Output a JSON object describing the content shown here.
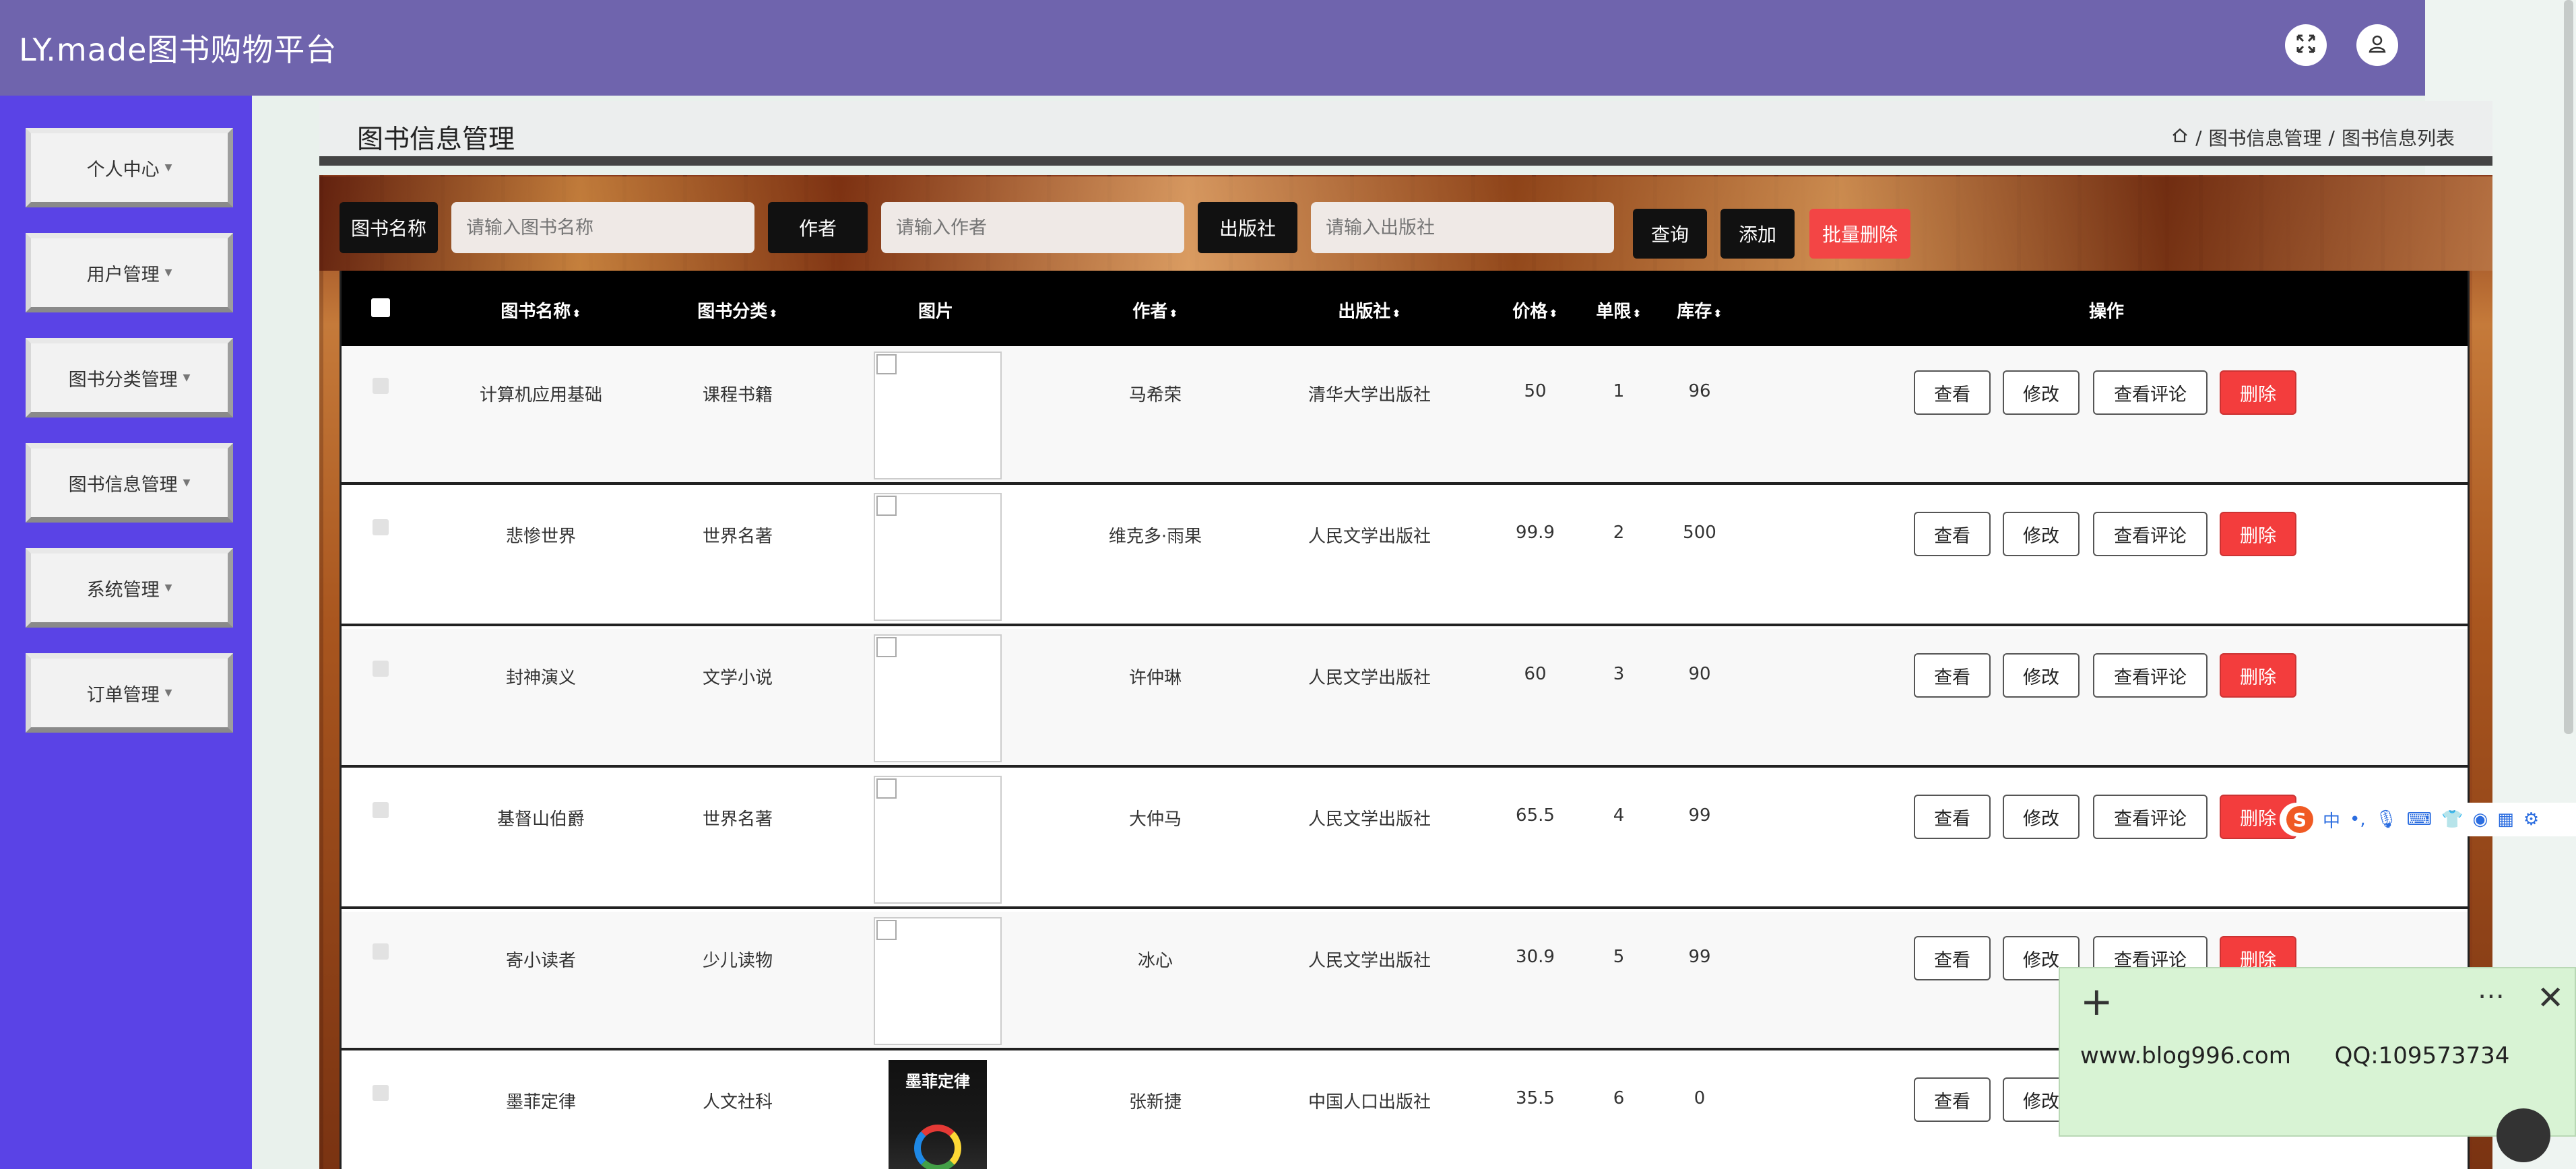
{
  "app": {
    "brand": "LY.made图书购物平台"
  },
  "header": {
    "fullscreen_icon": "expand-arrows-icon",
    "user_icon": "user-icon"
  },
  "sidebar": {
    "items": [
      {
        "label": "个人中心"
      },
      {
        "label": "用户管理"
      },
      {
        "label": "图书分类管理"
      },
      {
        "label": "图书信息管理"
      },
      {
        "label": "系统管理"
      },
      {
        "label": "订单管理"
      }
    ]
  },
  "page": {
    "title": "图书信息管理",
    "breadcrumb": [
      "图书信息管理",
      "图书信息列表"
    ],
    "breadcrumb_sep": "/"
  },
  "search": {
    "name_label": "图书名称",
    "name_placeholder": "请输入图书名称",
    "author_label": "作者",
    "author_placeholder": "请输入作者",
    "publisher_label": "出版社",
    "publisher_placeholder": "请输入出版社",
    "query_btn": "查询",
    "add_btn": "添加",
    "batch_delete_btn": "批量删除"
  },
  "table": {
    "headers": {
      "name": "图书名称",
      "category": "图书分类",
      "image": "图片",
      "author": "作者",
      "publisher": "出版社",
      "price": "价格",
      "limit": "单限",
      "stock": "库存",
      "actions": "操作"
    },
    "actions": {
      "view": "查看",
      "edit": "修改",
      "comments": "查看评论",
      "delete": "删除"
    },
    "rows": [
      {
        "name": "计算机应用基础",
        "category": "课程书籍",
        "author": "马希荣",
        "publisher": "清华大学出版社",
        "price": "50",
        "limit": "1",
        "stock": "96"
      },
      {
        "name": "悲惨世界",
        "category": "世界名著",
        "author": "维克多·雨果",
        "publisher": "人民文学出版社",
        "price": "99.9",
        "limit": "2",
        "stock": "500"
      },
      {
        "name": "封神演义",
        "category": "文学小说",
        "author": "许仲琳",
        "publisher": "人民文学出版社",
        "price": "60",
        "limit": "3",
        "stock": "90"
      },
      {
        "name": "基督山伯爵",
        "category": "世界名著",
        "author": "大仲马",
        "publisher": "人民文学出版社",
        "price": "65.5",
        "limit": "4",
        "stock": "99"
      },
      {
        "name": "寄小读者",
        "category": "少儿读物",
        "author": "冰心",
        "publisher": "人民文学出版社",
        "price": "30.9",
        "limit": "5",
        "stock": "99"
      },
      {
        "name": "墨菲定律",
        "category": "人文社科",
        "author": "张新捷",
        "publisher": "中国人口出版社",
        "price": "35.5",
        "limit": "6",
        "stock": "0",
        "cover_text": "墨菲定律"
      }
    ]
  },
  "note": {
    "text": "www.blog996.com      QQ:109573734"
  },
  "ime": {
    "lang": "中"
  }
}
